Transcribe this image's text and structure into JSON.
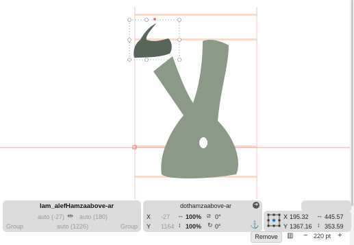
{
  "left_glyph": {
    "name": "lam_alefHamzaabove-ar",
    "lsb": "auto (-27)",
    "rsb": "auto (180)",
    "group_left_label": "Group",
    "group_value": "auto (1226)",
    "group_right_label": "Group"
  },
  "right_glyph": {
    "name": "dothamzaabove-ar"
  },
  "transform": {
    "x_label": "X",
    "x_value": "-27",
    "y_label": "Y",
    "y_value": "1164",
    "width_scale": "100%",
    "height_scale": "100%",
    "slant": "0°",
    "rotate": "0°"
  },
  "selection": {
    "x_label": "X",
    "x_value": "195.32",
    "y_label": "Y",
    "y_value": "1367.16",
    "width_value": "445.57",
    "height_value": "353.59"
  },
  "footer": {
    "remove_label": "Remove",
    "zoom_value": "220 pt",
    "minus": "−",
    "plus": "+"
  },
  "colors": {
    "glyph_fill": "#8a9a86",
    "component_fill": "#58665a",
    "metric_line": "#f4d6c8",
    "baseline": "#e08a8a",
    "panel_bg": "#dcdcdc"
  }
}
